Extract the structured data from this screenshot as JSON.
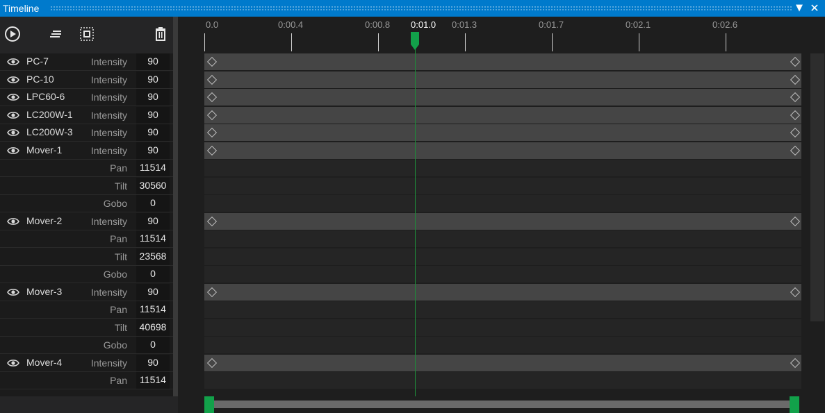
{
  "window": {
    "title": "Timeline"
  },
  "colors": {
    "accent": "#007acc",
    "playhead": "#1f8a3a",
    "handle": "#12a14a"
  },
  "toolbar": {
    "icons": [
      "play-circle-icon",
      "align-icon",
      "select-box-icon",
      "trash-icon"
    ]
  },
  "ruler": {
    "ticks": [
      "0.0",
      "0:00.4",
      "0:00.8",
      "0:01.3",
      "0:01.7",
      "0:02.1",
      "0:02.6"
    ],
    "current_time": "0:01.0"
  },
  "tracks": [
    {
      "fixture": "PC-7",
      "param": "Intensity",
      "value": "90",
      "keyframes": true
    },
    {
      "fixture": "PC-10",
      "param": "Intensity",
      "value": "90",
      "keyframes": true
    },
    {
      "fixture": "LPC60-6",
      "param": "Intensity",
      "value": "90",
      "keyframes": true
    },
    {
      "fixture": "LC200W-1",
      "param": "Intensity",
      "value": "90",
      "keyframes": true
    },
    {
      "fixture": "LC200W-3",
      "param": "Intensity",
      "value": "90",
      "keyframes": true
    },
    {
      "fixture": "Mover-1",
      "param": "Intensity",
      "value": "90",
      "keyframes": true
    },
    {
      "fixture": "",
      "param": "Pan",
      "value": "11514",
      "keyframes": false
    },
    {
      "fixture": "",
      "param": "Tilt",
      "value": "30560",
      "keyframes": false
    },
    {
      "fixture": "",
      "param": "Gobo",
      "value": "0",
      "keyframes": false
    },
    {
      "fixture": "Mover-2",
      "param": "Intensity",
      "value": "90",
      "keyframes": true
    },
    {
      "fixture": "",
      "param": "Pan",
      "value": "11514",
      "keyframes": false
    },
    {
      "fixture": "",
      "param": "Tilt",
      "value": "23568",
      "keyframes": false
    },
    {
      "fixture": "",
      "param": "Gobo",
      "value": "0",
      "keyframes": false
    },
    {
      "fixture": "Mover-3",
      "param": "Intensity",
      "value": "90",
      "keyframes": true
    },
    {
      "fixture": "",
      "param": "Pan",
      "value": "11514",
      "keyframes": false
    },
    {
      "fixture": "",
      "param": "Tilt",
      "value": "40698",
      "keyframes": false
    },
    {
      "fixture": "",
      "param": "Gobo",
      "value": "0",
      "keyframes": false
    },
    {
      "fixture": "Mover-4",
      "param": "Intensity",
      "value": "90",
      "keyframes": true
    },
    {
      "fixture": "",
      "param": "Pan",
      "value": "11514",
      "keyframes": false
    }
  ]
}
